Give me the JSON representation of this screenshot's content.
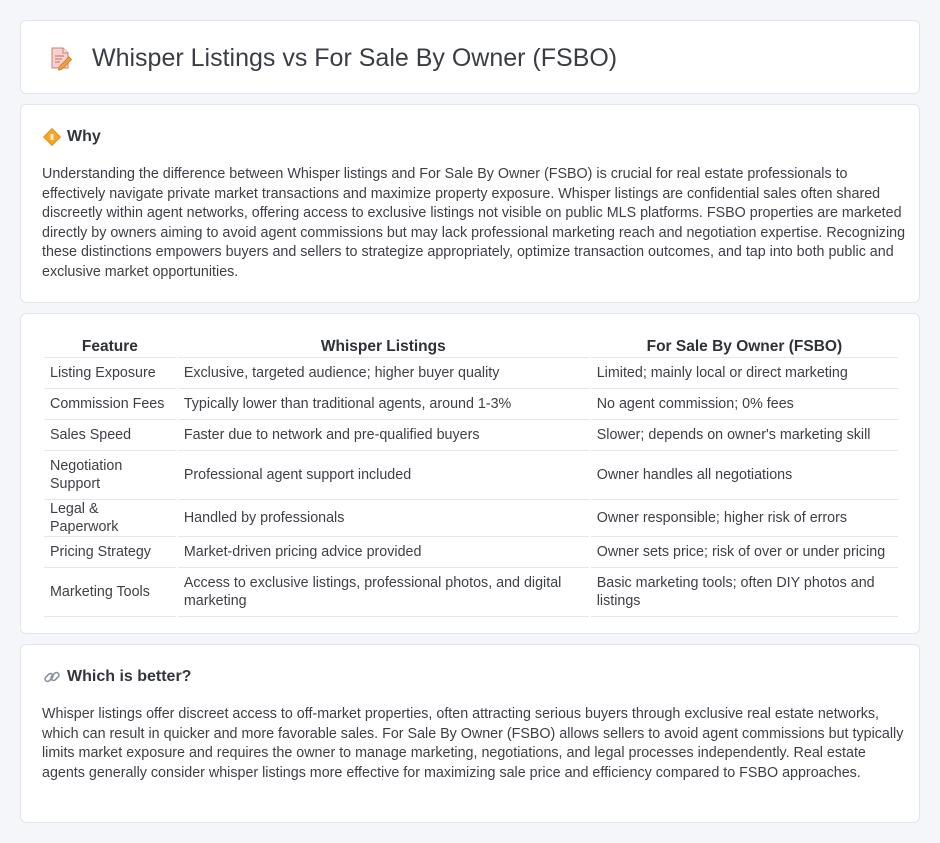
{
  "header": {
    "title": "Whisper Listings vs For Sale By Owner (FSBO)",
    "icon": "document-pencil-icon"
  },
  "why": {
    "heading": "Why",
    "icon": "diamond-sign-icon",
    "text": "Understanding the difference between Whisper listings and For Sale By Owner (FSBO) is crucial for real estate professionals to effectively navigate private market transactions and maximize property exposure. Whisper listings are confidential sales often shared discreetly within agent networks, offering access to exclusive listings not visible on public MLS platforms. FSBO properties are marketed directly by owners aiming to avoid agent commissions but may lack professional marketing reach and negotiation expertise. Recognizing these distinctions empowers buyers and sellers to strategize appropriately, optimize transaction outcomes, and tap into both public and exclusive market opportunities."
  },
  "table": {
    "headers": [
      "Feature",
      "Whisper Listings",
      "For Sale By Owner (FSBO)"
    ],
    "rows": [
      [
        "Listing Exposure",
        "Exclusive, targeted audience; higher buyer quality",
        "Limited; mainly local or direct marketing"
      ],
      [
        "Commission Fees",
        "Typically lower than traditional agents, around 1-3%",
        "No agent commission; 0% fees"
      ],
      [
        "Sales Speed",
        "Faster due to network and pre-qualified buyers",
        "Slower; depends on owner's marketing skill"
      ],
      [
        "Negotiation Support",
        "Professional agent support included",
        "Owner handles all negotiations"
      ],
      [
        "Legal & Paperwork",
        "Handled by professionals",
        "Owner responsible; higher risk of errors"
      ],
      [
        "Pricing Strategy",
        "Market-driven pricing advice provided",
        "Owner sets price; risk of over or under pricing"
      ],
      [
        "Marketing Tools",
        "Access to exclusive listings, professional photos, and digital marketing",
        "Basic marketing tools; often DIY photos and listings"
      ]
    ]
  },
  "better": {
    "heading": "Which is better?",
    "icon": "link-icon",
    "text": "Whisper listings offer discreet access to off-market properties, often attracting serious buyers through exclusive real estate networks, which can result in quicker and more favorable sales. For Sale By Owner (FSBO) allows sellers to avoid agent commissions but typically limits market exposure and requires the owner to manage marketing, negotiations, and legal processes independently. Real estate agents generally consider whisper listings more effective for maximizing sale price and efficiency compared to FSBO approaches."
  }
}
